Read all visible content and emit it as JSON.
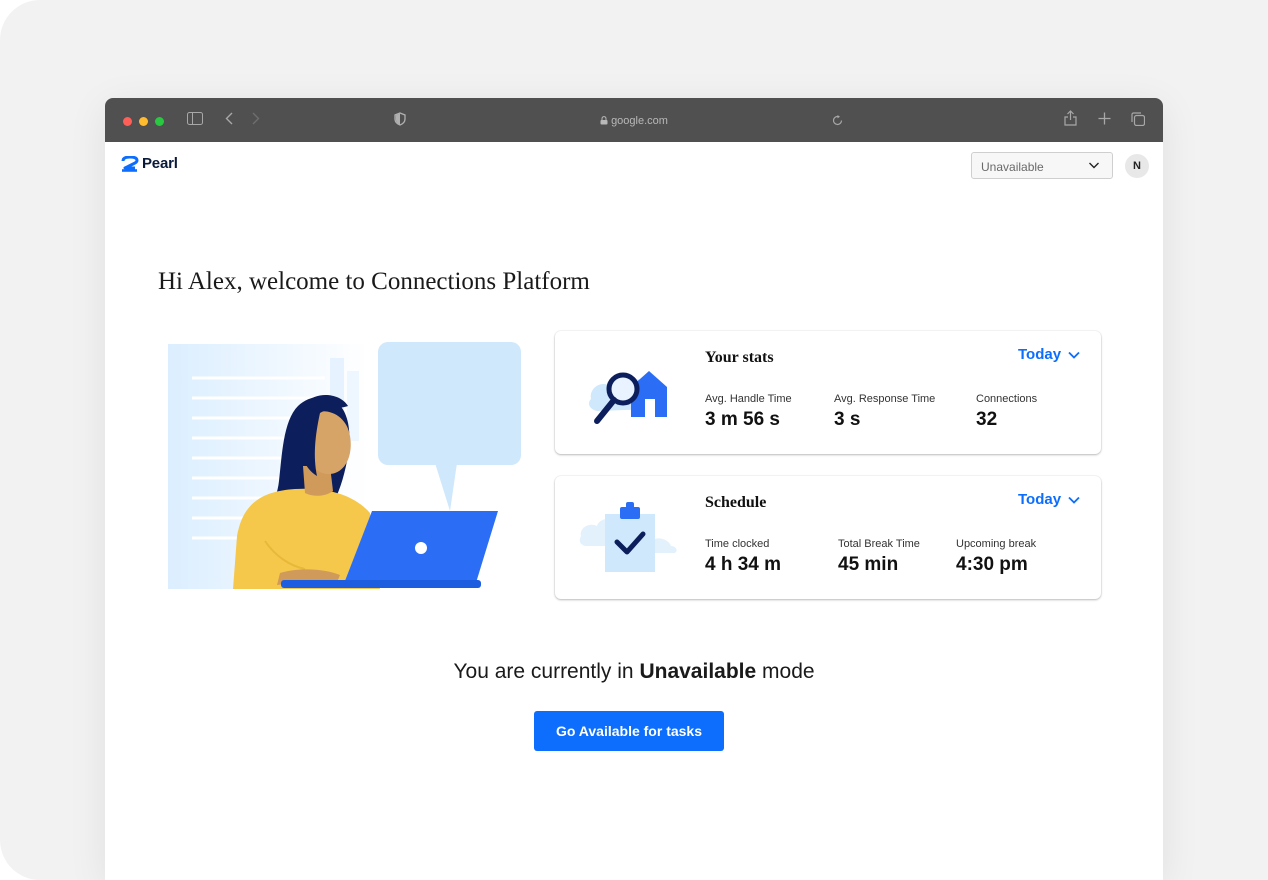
{
  "browser": {
    "url": "google.com",
    "traffic_lights": [
      "#ff5f57",
      "#febc2e",
      "#28c840"
    ]
  },
  "header": {
    "logo_text": "Pearl",
    "status_select": {
      "selected": "Unavailable"
    },
    "avatar_initial": "N"
  },
  "welcome": {
    "title": "Hi Alex, welcome to Connections Platform"
  },
  "stats_card": {
    "title": "Your stats",
    "period": "Today",
    "stats": [
      {
        "label": "Avg. Handle Time",
        "value": "3 m 56 s"
      },
      {
        "label": "Avg. Response Time",
        "value": "3 s"
      },
      {
        "label": "Connections",
        "value": "32"
      }
    ]
  },
  "schedule_card": {
    "title": "Schedule",
    "period": "Today",
    "stats": [
      {
        "label": "Time clocked",
        "value": "4 h 34 m"
      },
      {
        "label": "Total Break Time",
        "value": "45 min"
      },
      {
        "label": "Upcoming break",
        "value": "4:30 pm"
      }
    ]
  },
  "mode": {
    "prefix": "You are currently in",
    "mode_name": "Unavailable",
    "suffix": "mode"
  },
  "cta": {
    "label": "Go Available for tasks"
  },
  "colors": {
    "accent": "#0d6efd",
    "titlebar": "#505050"
  }
}
